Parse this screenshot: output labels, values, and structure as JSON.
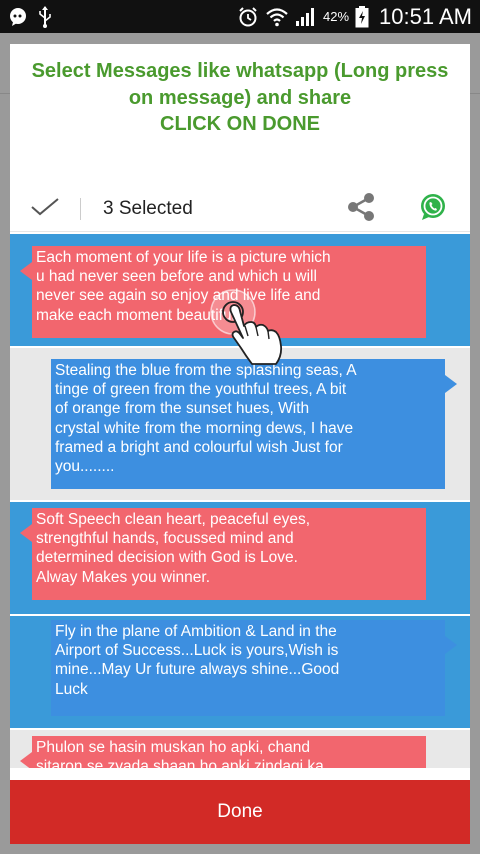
{
  "status_bar": {
    "battery_percent": "42%",
    "time": "10:51 AM",
    "icons": [
      "chat-bubble-icon",
      "usb-icon",
      "alarm-icon",
      "wifi-icon",
      "signal-icon",
      "battery-charging-icon"
    ]
  },
  "dialog": {
    "instruction_line1": "Select Messages like whatsapp (Long press",
    "instruction_line2": "on message) and share",
    "instruction_line3": "CLICK ON DONE",
    "toolbar": {
      "selected_count": "3 Selected",
      "icons": [
        "check-icon",
        "share-icon",
        "whatsapp-icon"
      ]
    },
    "messages": [
      {
        "lines": [
          "Each moment of your life is a picture which",
          "u had never seen before and which u will",
          "never see again so enjoy and live life and",
          "make each moment beautiful."
        ],
        "side": "left",
        "selected": true
      },
      {
        "lines": [
          "Stealing the blue from the splashing seas, A",
          "tinge of green from the youthful trees, A bit",
          "of orange from the sunset hues, With",
          "crystal white from the morning dews, I have",
          "framed a bright and colourful wish Just for",
          "you........"
        ],
        "side": "right",
        "selected": false
      },
      {
        "lines": [
          "Soft Speech clean heart, peaceful eyes,",
          "strengthful hands, focussed mind and",
          "determined decision with God is Love.",
          "Alway Makes you winner."
        ],
        "side": "left",
        "selected": true
      },
      {
        "lines": [
          "Fly in the plane of Ambition & Land in the",
          "Airport of Success...Luck is yours,Wish is",
          "mine...May Ur future always shine...Good",
          "Luck"
        ],
        "side": "right",
        "selected": true
      },
      {
        "lines": [
          "Phulon se hasin muskan ho apki, chand",
          "sitaron se zyada shaan ho apki zindagi ka"
        ],
        "side": "left",
        "selected": false
      }
    ],
    "done_label": "Done"
  },
  "colors": {
    "instruction_green": "#4a9a2e",
    "selected_row_blue": "#3a9ad9",
    "bubble_red": "#f2666e",
    "bubble_blue": "#3d8fe0",
    "done_red": "#d22a26"
  }
}
